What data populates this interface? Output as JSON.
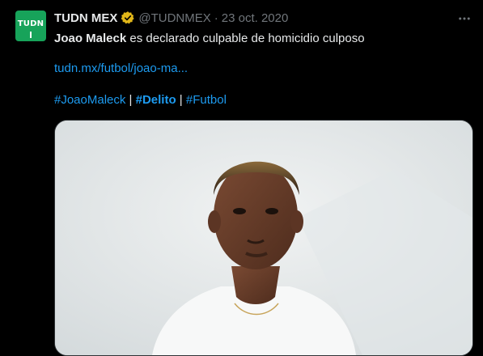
{
  "tweet": {
    "author": {
      "display_name": "TUDN MEX",
      "handle": "@TUDNMEX",
      "avatar_text": "TUDN",
      "verified_icon": "verified-gold-badge-icon"
    },
    "separator": "·",
    "timestamp": "23 oct. 2020",
    "more_icon": "more-horizontal-icon",
    "headline_bold": "Joao Maleck",
    "headline_rest": " es declarado culpable de homicidio culposo",
    "link": "tudn.mx/futbol/joao-ma...",
    "hashtags": [
      {
        "text": "#JoaoMaleck",
        "bold": false
      },
      {
        "text": "#Delito",
        "bold": true
      },
      {
        "text": "#Futbol",
        "bold": false
      }
    ],
    "hashtag_divider": " | ",
    "media": {
      "description_icon": "player-photo-image"
    }
  },
  "colors": {
    "background": "#000000",
    "text": "#e7e9ea",
    "muted": "#71767b",
    "link": "#1d9bf0",
    "verified": "#e2b719",
    "avatar": "#17a35a"
  }
}
